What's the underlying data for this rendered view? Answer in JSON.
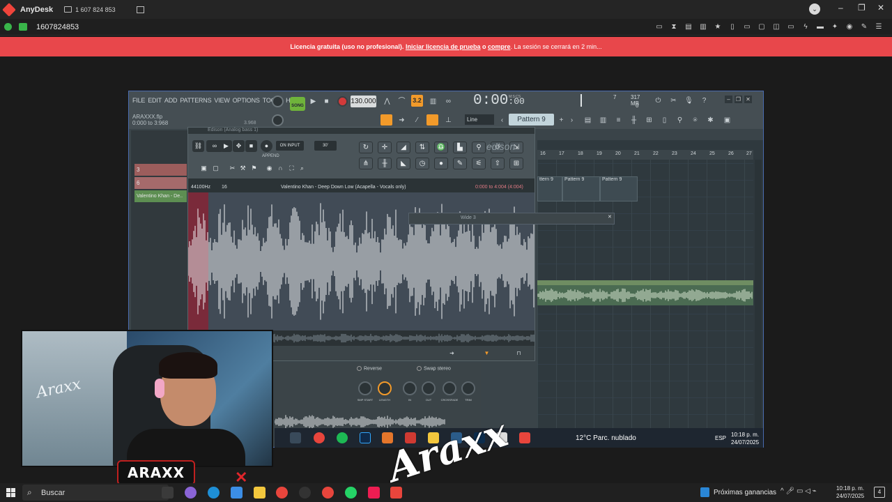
{
  "anydesk": {
    "app_name": "AnyDesk",
    "session_tab": "1 607 824 853",
    "address": "1607824853",
    "window_controls": [
      "–",
      "❐",
      "✕"
    ]
  },
  "banner": {
    "part1": "Licencia gratuita (uso no profesional).",
    "link1": "Iniciar licencia de prueba",
    "sep": " o ",
    "link2": "compre",
    "part2": ". La sesión se cerrará en 2 min..."
  },
  "fl": {
    "menu": [
      "FILE",
      "EDIT",
      "ADD",
      "PATTERNS",
      "VIEW",
      "OPTIONS",
      "TOOLS",
      "HELP"
    ],
    "file_name": "ARAXXX.flp",
    "file_range": "0:000 to 3:968",
    "file_len": "3.968",
    "song_label": "SONG",
    "tempo": "130.000",
    "time": "0:00",
    "time_small": ":00",
    "time_label": "M:S:CS",
    "cpu_a": "7",
    "cpu_b": "317 MB",
    "cpu_c": "0",
    "snap": "Line",
    "pattern": "Pattern 9",
    "orange_label": "3.2"
  },
  "browser": {
    "items": [
      "3",
      "6",
      "Valentino Khan - De.."
    ]
  },
  "playlist": {
    "ruler": [
      "16",
      "17",
      "18",
      "19",
      "20",
      "21",
      "22",
      "23",
      "24",
      "25",
      "26",
      "27"
    ],
    "clips": [
      "ttern 9",
      "Pattern 9",
      "Pattern 9"
    ]
  },
  "edison": {
    "title": "Edison (Analog bass 1)",
    "on_input": "ON INPUT",
    "time_limit": "30'",
    "append": "APPEND",
    "logo": "edison",
    "sample_rate": "44100Hz",
    "bits": "16",
    "file_title": "Valentino Khan - Deep Down Low (Acapella - Vocals only)",
    "selection": "0:000 to 4:004 (4:004)"
  },
  "wide": {
    "title": "Wide 3"
  },
  "channel": {
    "reverse": "Reverse",
    "swap": "Swap stereo",
    "knobs": [
      "SMP START",
      "LENGTH",
      "IN",
      "OUT",
      "CROSSFADE",
      "TRIM"
    ]
  },
  "remote_taskbar": {
    "weather": "12°C  Parc. nublado",
    "lang": "ESP",
    "time": "10:18 p. m.",
    "date": "24/07/2025"
  },
  "overlay": {
    "cam_text": "Araxx",
    "brand": "ARAXX",
    "signature": "Araxx"
  },
  "taskbar": {
    "search": "Buscar",
    "news": "Próximas ganancias",
    "time": "10:18 p. m.",
    "date": "24/07/2025",
    "notif_count": "4"
  },
  "colors": {
    "banner": "#e8474b",
    "fl_accent_orange": "#f29a2a",
    "fl_song_green": "#6fb33b",
    "edison_selection": "#7a2a3a"
  }
}
